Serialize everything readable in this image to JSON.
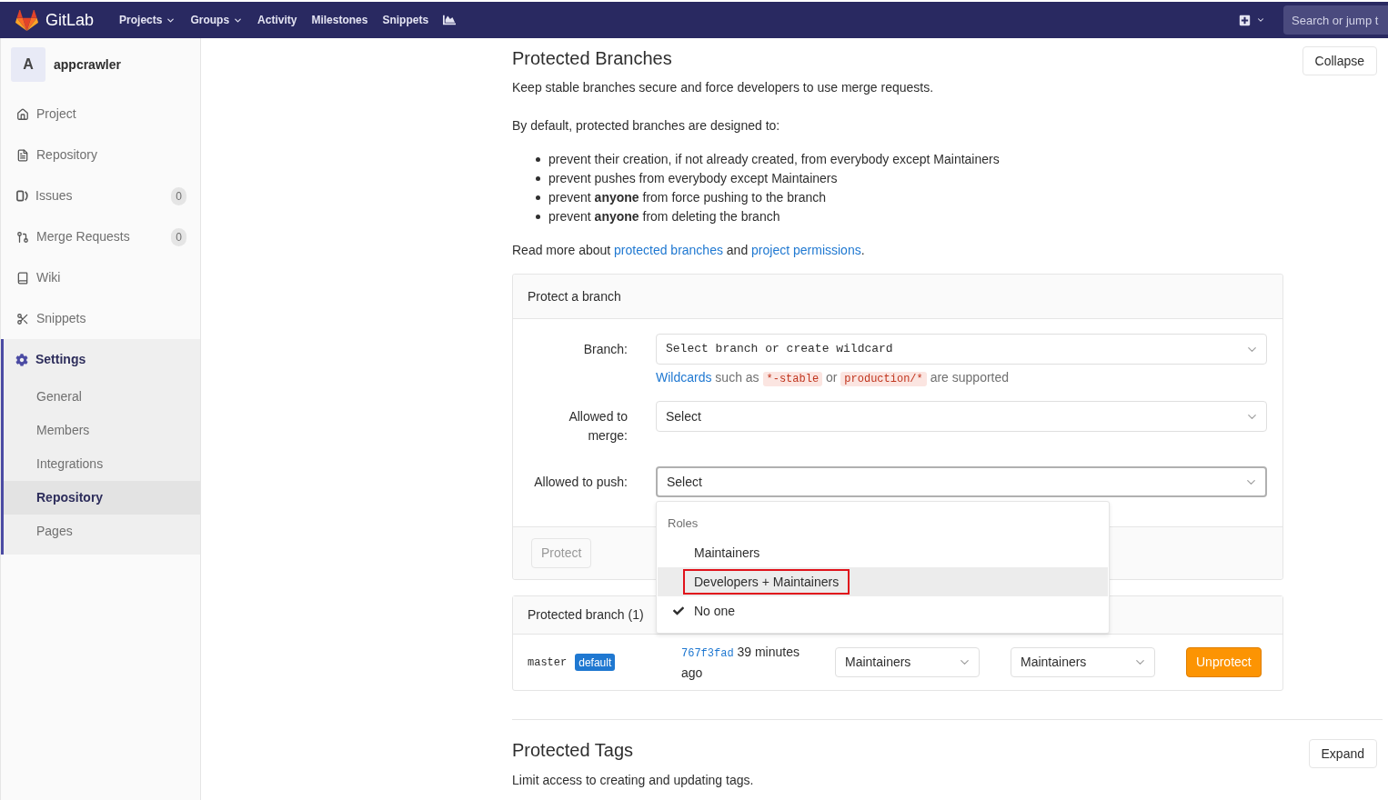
{
  "navbar": {
    "logo_text": "GitLab",
    "items": [
      {
        "label": "Projects",
        "dropdown": true
      },
      {
        "label": "Groups",
        "dropdown": true
      },
      {
        "label": "Activity",
        "dropdown": false
      },
      {
        "label": "Milestones",
        "dropdown": false
      },
      {
        "label": "Snippets",
        "dropdown": false
      }
    ],
    "search": {
      "placeholder": "Search or jump t"
    }
  },
  "sidebar": {
    "project": {
      "avatar": "A",
      "name": "appcrawler"
    },
    "items": [
      {
        "label": "Project",
        "selected": false
      },
      {
        "label": "Repository",
        "selected": false
      },
      {
        "label": "Issues",
        "selected": false,
        "count": "0"
      },
      {
        "label": "Merge Requests",
        "selected": false,
        "count": "0"
      },
      {
        "label": "Wiki",
        "selected": false
      },
      {
        "label": "Snippets",
        "selected": false
      },
      {
        "label": "Settings",
        "selected": true,
        "expanded": true,
        "children": [
          {
            "label": "General",
            "selected": false
          },
          {
            "label": "Members",
            "selected": false
          },
          {
            "label": "Integrations",
            "selected": false
          },
          {
            "label": "Repository",
            "selected": true
          },
          {
            "label": "Pages",
            "selected": false
          }
        ]
      }
    ]
  },
  "protected_branches": {
    "title": "Protected Branches",
    "toggle_button": "Collapse",
    "description": "Keep stable branches secure and force developers to use merge requests.",
    "intro": "By default, protected branches are designed to:",
    "rules": [
      "prevent their creation, if not already created, from everybody except Maintainers",
      "prevent pushes from everybody except Maintainers",
      "prevent **anyone** from force pushing to the branch",
      "prevent **anyone** from deleting the branch"
    ],
    "read_more": [
      {
        "kind": "text",
        "text": "Read more about "
      },
      {
        "kind": "link",
        "text": "protected branches"
      },
      {
        "kind": "text",
        "text": " and "
      },
      {
        "kind": "link",
        "text": "project permissions"
      },
      {
        "kind": "text",
        "text": "."
      }
    ],
    "protect_form": {
      "title": "Protect a branch",
      "fields": [
        {
          "kind": "branch",
          "label": "Branch:",
          "toggle": "Select branch or create wildcard",
          "expanded": false,
          "hint": [
            {
              "kind": "link",
              "text": "Wildcards"
            },
            {
              "kind": "text",
              "text": " such as "
            },
            {
              "kind": "code",
              "text": "*-stable"
            },
            {
              "kind": "text",
              "text": " or "
            },
            {
              "kind": "code",
              "text": "production/*"
            },
            {
              "kind": "text",
              "text": " are supported"
            }
          ]
        },
        {
          "kind": "role",
          "label": "Allowed to merge:",
          "toggle": "Select",
          "expanded": false
        },
        {
          "kind": "role",
          "label": "Allowed to push:",
          "toggle": "Select",
          "expanded": true,
          "menu": {
            "header": "Roles",
            "items": [
              {
                "label": "Maintainers",
                "selected": false,
                "highlighted": false,
                "outlined": false
              },
              {
                "label": "Developers + Maintainers",
                "selected": false,
                "highlighted": true,
                "outlined": true
              },
              {
                "label": "No one",
                "selected": true,
                "highlighted": false,
                "outlined": false
              }
            ]
          }
        }
      ],
      "submit": {
        "label": "Protect",
        "disabled": true
      }
    },
    "protected_list": {
      "title": "Protected branch (1)",
      "rows": [
        {
          "branch": "master",
          "badge": "default",
          "commit": "767f3fad",
          "time": "39 minutes ago",
          "allowed_to_merge": "Maintainers",
          "allowed_to_push": "Maintainers",
          "action": "Unprotect"
        }
      ]
    }
  },
  "protected_tags": {
    "title": "Protected Tags",
    "toggle_button": "Expand",
    "description": "Limit access to creating and updating tags."
  }
}
